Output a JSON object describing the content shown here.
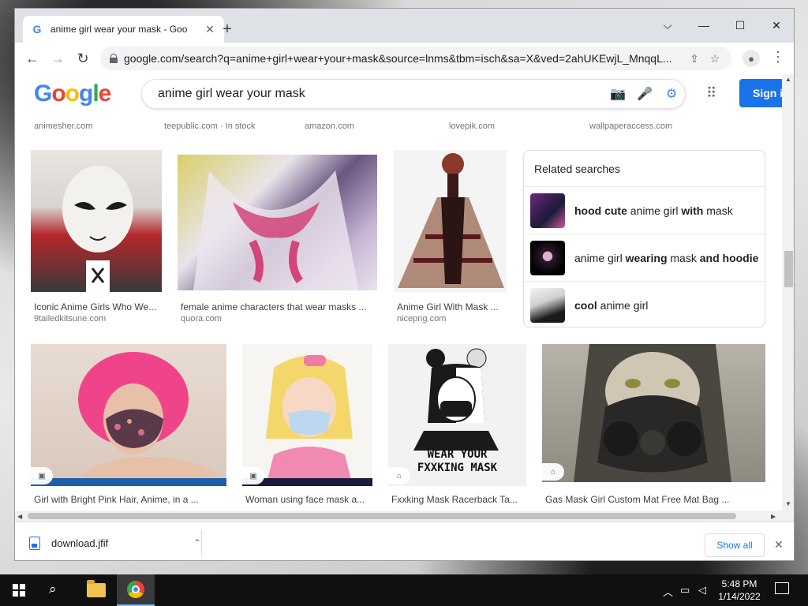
{
  "browser": {
    "tab_title": "anime girl wear your mask - Goo",
    "url": "google.com/search?q=anime+girl+wear+your+mask&source=lnms&tbm=isch&sa=X&ved=2ahUKEwjL_MnqqL..."
  },
  "google": {
    "logo_letters": [
      "G",
      "o",
      "o",
      "g",
      "l",
      "e"
    ],
    "search_query": "anime girl wear your mask",
    "sign_in_label": "Sign i"
  },
  "cut_off_sources": [
    "animesher.com",
    "teepublic.com · In stock",
    "amazon.com",
    "lovepik.com",
    "wallpaperaccess.com"
  ],
  "results_row1": [
    {
      "title": "Iconic Anime Girls Who We...",
      "source": "9tailedkitsune.com"
    },
    {
      "title": "female anime characters that wear masks ...",
      "source": "quora.com"
    },
    {
      "title": "Anime Girl With Mask ...",
      "source": "nicepng.com"
    }
  ],
  "related_searches": {
    "title": "Related searches",
    "items": [
      {
        "bold1": "hood cute",
        "plain1": " anime girl ",
        "bold2": "with",
        "plain2": " mask"
      },
      {
        "bold1": "",
        "plain1": "anime girl ",
        "bold2": "wearing",
        "plain2": " mask ",
        "bold3": "and hoodie"
      },
      {
        "bold1": "cool",
        "plain1": " anime girl",
        "bold2": "",
        "plain2": ""
      }
    ]
  },
  "results_row2": [
    {
      "title": "Girl with Bright Pink Hair, Anime, in a ...",
      "badge_icon": "image-icon"
    },
    {
      "title": "Woman using face mask a...",
      "badge_icon": "image-icon"
    },
    {
      "title": "Fxxking Mask Racerback Ta...",
      "badge_icon": "tag-icon",
      "image_text": "WEAR YOUR FXXKING MASK"
    },
    {
      "title": "Gas Mask Girl Custom Mat Free Mat Bag ...",
      "badge_icon": "tag-icon"
    }
  ],
  "downloads": {
    "file_name": "download.jfif",
    "show_all_label": "Show all"
  },
  "taskbar": {
    "time": "5:48 PM",
    "date": "1/14/2022"
  }
}
